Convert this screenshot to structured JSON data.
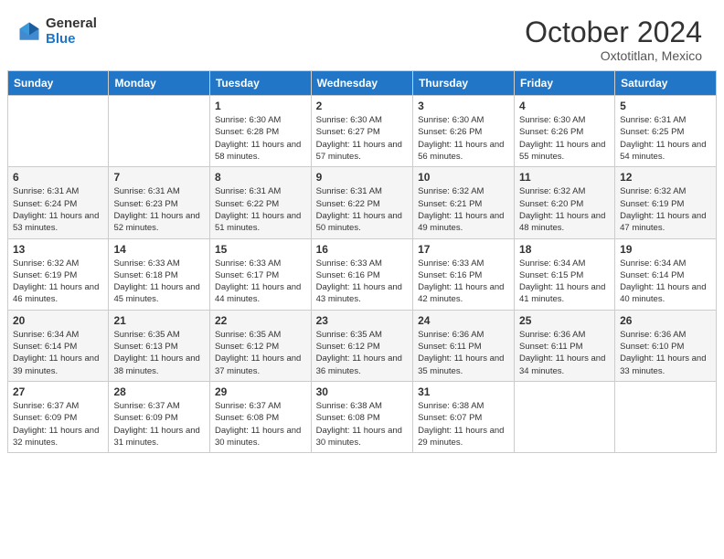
{
  "header": {
    "logo_general": "General",
    "logo_blue": "Blue",
    "month_title": "October 2024",
    "subtitle": "Oxtotitlan, Mexico"
  },
  "days_of_week": [
    "Sunday",
    "Monday",
    "Tuesday",
    "Wednesday",
    "Thursday",
    "Friday",
    "Saturday"
  ],
  "weeks": [
    [
      {
        "day": "",
        "info": ""
      },
      {
        "day": "",
        "info": ""
      },
      {
        "day": "1",
        "info": "Sunrise: 6:30 AM\nSunset: 6:28 PM\nDaylight: 11 hours and 58 minutes."
      },
      {
        "day": "2",
        "info": "Sunrise: 6:30 AM\nSunset: 6:27 PM\nDaylight: 11 hours and 57 minutes."
      },
      {
        "day": "3",
        "info": "Sunrise: 6:30 AM\nSunset: 6:26 PM\nDaylight: 11 hours and 56 minutes."
      },
      {
        "day": "4",
        "info": "Sunrise: 6:30 AM\nSunset: 6:26 PM\nDaylight: 11 hours and 55 minutes."
      },
      {
        "day": "5",
        "info": "Sunrise: 6:31 AM\nSunset: 6:25 PM\nDaylight: 11 hours and 54 minutes."
      }
    ],
    [
      {
        "day": "6",
        "info": "Sunrise: 6:31 AM\nSunset: 6:24 PM\nDaylight: 11 hours and 53 minutes."
      },
      {
        "day": "7",
        "info": "Sunrise: 6:31 AM\nSunset: 6:23 PM\nDaylight: 11 hours and 52 minutes."
      },
      {
        "day": "8",
        "info": "Sunrise: 6:31 AM\nSunset: 6:22 PM\nDaylight: 11 hours and 51 minutes."
      },
      {
        "day": "9",
        "info": "Sunrise: 6:31 AM\nSunset: 6:22 PM\nDaylight: 11 hours and 50 minutes."
      },
      {
        "day": "10",
        "info": "Sunrise: 6:32 AM\nSunset: 6:21 PM\nDaylight: 11 hours and 49 minutes."
      },
      {
        "day": "11",
        "info": "Sunrise: 6:32 AM\nSunset: 6:20 PM\nDaylight: 11 hours and 48 minutes."
      },
      {
        "day": "12",
        "info": "Sunrise: 6:32 AM\nSunset: 6:19 PM\nDaylight: 11 hours and 47 minutes."
      }
    ],
    [
      {
        "day": "13",
        "info": "Sunrise: 6:32 AM\nSunset: 6:19 PM\nDaylight: 11 hours and 46 minutes."
      },
      {
        "day": "14",
        "info": "Sunrise: 6:33 AM\nSunset: 6:18 PM\nDaylight: 11 hours and 45 minutes."
      },
      {
        "day": "15",
        "info": "Sunrise: 6:33 AM\nSunset: 6:17 PM\nDaylight: 11 hours and 44 minutes."
      },
      {
        "day": "16",
        "info": "Sunrise: 6:33 AM\nSunset: 6:16 PM\nDaylight: 11 hours and 43 minutes."
      },
      {
        "day": "17",
        "info": "Sunrise: 6:33 AM\nSunset: 6:16 PM\nDaylight: 11 hours and 42 minutes."
      },
      {
        "day": "18",
        "info": "Sunrise: 6:34 AM\nSunset: 6:15 PM\nDaylight: 11 hours and 41 minutes."
      },
      {
        "day": "19",
        "info": "Sunrise: 6:34 AM\nSunset: 6:14 PM\nDaylight: 11 hours and 40 minutes."
      }
    ],
    [
      {
        "day": "20",
        "info": "Sunrise: 6:34 AM\nSunset: 6:14 PM\nDaylight: 11 hours and 39 minutes."
      },
      {
        "day": "21",
        "info": "Sunrise: 6:35 AM\nSunset: 6:13 PM\nDaylight: 11 hours and 38 minutes."
      },
      {
        "day": "22",
        "info": "Sunrise: 6:35 AM\nSunset: 6:12 PM\nDaylight: 11 hours and 37 minutes."
      },
      {
        "day": "23",
        "info": "Sunrise: 6:35 AM\nSunset: 6:12 PM\nDaylight: 11 hours and 36 minutes."
      },
      {
        "day": "24",
        "info": "Sunrise: 6:36 AM\nSunset: 6:11 PM\nDaylight: 11 hours and 35 minutes."
      },
      {
        "day": "25",
        "info": "Sunrise: 6:36 AM\nSunset: 6:11 PM\nDaylight: 11 hours and 34 minutes."
      },
      {
        "day": "26",
        "info": "Sunrise: 6:36 AM\nSunset: 6:10 PM\nDaylight: 11 hours and 33 minutes."
      }
    ],
    [
      {
        "day": "27",
        "info": "Sunrise: 6:37 AM\nSunset: 6:09 PM\nDaylight: 11 hours and 32 minutes."
      },
      {
        "day": "28",
        "info": "Sunrise: 6:37 AM\nSunset: 6:09 PM\nDaylight: 11 hours and 31 minutes."
      },
      {
        "day": "29",
        "info": "Sunrise: 6:37 AM\nSunset: 6:08 PM\nDaylight: 11 hours and 30 minutes."
      },
      {
        "day": "30",
        "info": "Sunrise: 6:38 AM\nSunset: 6:08 PM\nDaylight: 11 hours and 30 minutes."
      },
      {
        "day": "31",
        "info": "Sunrise: 6:38 AM\nSunset: 6:07 PM\nDaylight: 11 hours and 29 minutes."
      },
      {
        "day": "",
        "info": ""
      },
      {
        "day": "",
        "info": ""
      }
    ]
  ]
}
